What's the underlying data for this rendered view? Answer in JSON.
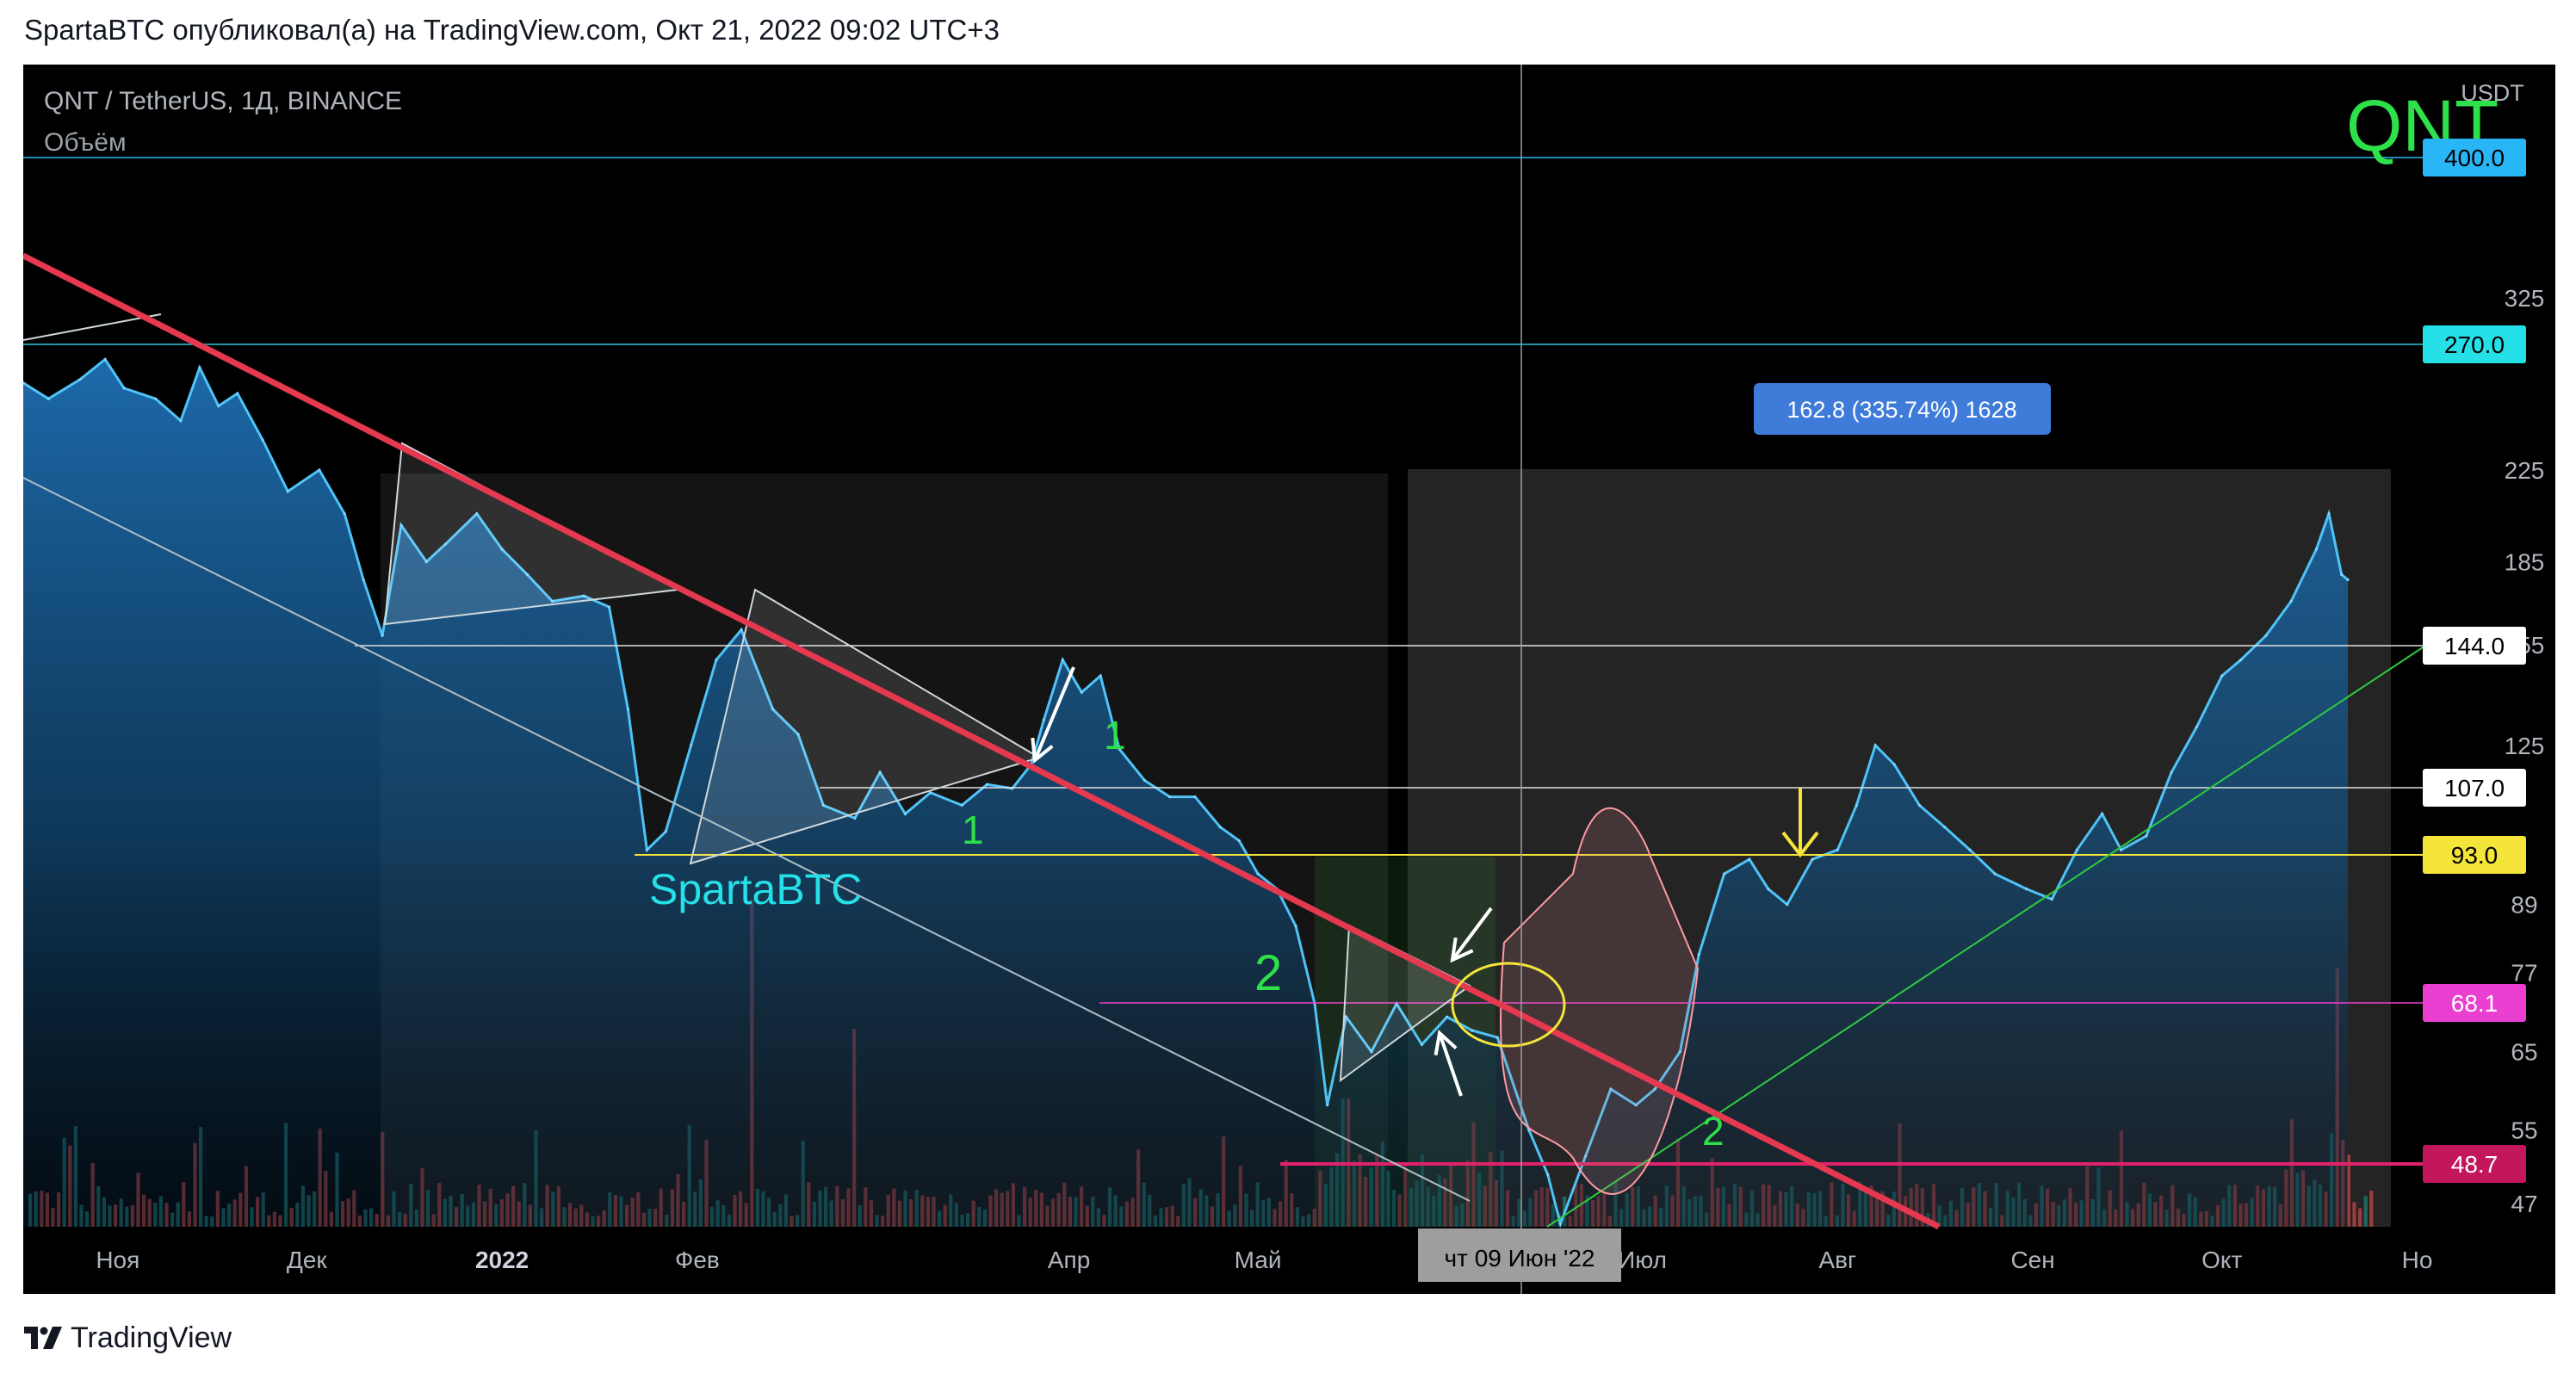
{
  "header": {
    "caption": "SpartaBTC опубликовал(а) на TradingView.com, Окт 21, 2022 09:02 UTC+3"
  },
  "footer": {
    "brand": "TradingView"
  },
  "chart": {
    "symbol_title": "QNT / TetherUS, 1Д, BINANCE",
    "volume_label": "Объём",
    "currency": "USDT",
    "watermark": "QNT",
    "author_tag": "SpartaBTC",
    "measure_label": "162.8 (335.74%) 1628",
    "crosshair_date": "чт 09 Июн '22",
    "annotations": {
      "one_a": "1",
      "one_b": "1",
      "two_a": "2",
      "two_b": "2"
    }
  },
  "chart_data": {
    "type": "area",
    "title": "QNT / TetherUS, 1Д, BINANCE",
    "y_scale": "log",
    "ylim": [
      44,
      470
    ],
    "y_ticks": [
      47.0,
      55.0,
      65.0,
      77.0,
      89.0,
      125.0,
      155.0,
      185.0,
      225.0,
      325.0
    ],
    "x_ticks": [
      "Ноя",
      "Дек",
      "2022",
      "Фев",
      "Апр",
      "Май",
      "Июл",
      "Авг",
      "Сен",
      "Окт",
      "Но"
    ],
    "x_tick_dates": [
      "2021-11-01",
      "2021-12-01",
      "2022-01-01",
      "2022-02-01",
      "2022-04-01",
      "2022-05-01",
      "2022-07-01",
      "2022-08-01",
      "2022-09-01",
      "2022-10-01",
      "2022-11-01"
    ],
    "price_labels": [
      {
        "value": "400.0",
        "bg": "#29b6f6",
        "fg": "#000000"
      },
      {
        "value": "270.0",
        "bg": "#26e0e8",
        "fg": "#000000"
      },
      {
        "value": "144.0",
        "bg": "#ffffff",
        "fg": "#000000"
      },
      {
        "value": "107.0",
        "bg": "#ffffff",
        "fg": "#000000"
      },
      {
        "value": "93.0",
        "bg": "#f5e43a",
        "fg": "#000000"
      },
      {
        "value": "68.1",
        "bg": "#ea3fd0",
        "fg": "#ffffff"
      },
      {
        "value": "48.7",
        "bg": "#c2185b",
        "fg": "#ffffff"
      }
    ],
    "series": [
      {
        "name": "QNT/USDT close",
        "color": "#4fc3f7",
        "points": [
          [
            "2021-10-17",
            271
          ],
          [
            "2021-10-21",
            262
          ],
          [
            "2021-10-26",
            273
          ],
          [
            "2021-10-30",
            285
          ],
          [
            "2021-11-02",
            268
          ],
          [
            "2021-11-07",
            262
          ],
          [
            "2021-11-11",
            250
          ],
          [
            "2021-11-14",
            280
          ],
          [
            "2021-11-17",
            258
          ],
          [
            "2021-11-20",
            265
          ],
          [
            "2021-11-24",
            240
          ],
          [
            "2021-11-28",
            215
          ],
          [
            "2021-12-03",
            225
          ],
          [
            "2021-12-07",
            205
          ],
          [
            "2021-12-10",
            178
          ],
          [
            "2021-12-13",
            158
          ],
          [
            "2021-12-16",
            200
          ],
          [
            "2021-12-20",
            185
          ],
          [
            "2021-12-23",
            192
          ],
          [
            "2021-12-28",
            205
          ],
          [
            "2022-01-01",
            190
          ],
          [
            "2022-01-05",
            180
          ],
          [
            "2022-01-09",
            170
          ],
          [
            "2022-01-14",
            172
          ],
          [
            "2022-01-18",
            168
          ],
          [
            "2022-01-21",
            135
          ],
          [
            "2022-01-24",
            100
          ],
          [
            "2022-01-27",
            104
          ],
          [
            "2022-01-31",
            125
          ],
          [
            "2022-02-04",
            150
          ],
          [
            "2022-02-08",
            160
          ],
          [
            "2022-02-13",
            135
          ],
          [
            "2022-02-17",
            128
          ],
          [
            "2022-02-21",
            110
          ],
          [
            "2022-02-26",
            107
          ],
          [
            "2022-03-02",
            118
          ],
          [
            "2022-03-06",
            108
          ],
          [
            "2022-03-10",
            113
          ],
          [
            "2022-03-15",
            110
          ],
          [
            "2022-03-19",
            115
          ],
          [
            "2022-03-23",
            114
          ],
          [
            "2022-03-26",
            120
          ],
          [
            "2022-03-28",
            132
          ],
          [
            "2022-03-31",
            150
          ],
          [
            "2022-04-03",
            140
          ],
          [
            "2022-04-06",
            145
          ],
          [
            "2022-04-09",
            124
          ],
          [
            "2022-04-13",
            116
          ],
          [
            "2022-04-17",
            112
          ],
          [
            "2022-04-21",
            112
          ],
          [
            "2022-04-25",
            105
          ],
          [
            "2022-04-28",
            102
          ],
          [
            "2022-05-01",
            95
          ],
          [
            "2022-05-04",
            92
          ],
          [
            "2022-05-07",
            85
          ],
          [
            "2022-05-10",
            72
          ],
          [
            "2022-05-12",
            58
          ],
          [
            "2022-05-15",
            70
          ],
          [
            "2022-05-19",
            65
          ],
          [
            "2022-05-23",
            72
          ],
          [
            "2022-05-27",
            66
          ],
          [
            "2022-05-31",
            70
          ],
          [
            "2022-06-04",
            68
          ],
          [
            "2022-06-08",
            67
          ],
          [
            "2022-06-13",
            55
          ],
          [
            "2022-06-16",
            50
          ],
          [
            "2022-06-18",
            45
          ],
          [
            "2022-06-22",
            52
          ],
          [
            "2022-06-26",
            60
          ],
          [
            "2022-06-30",
            58
          ],
          [
            "2022-07-03",
            60
          ],
          [
            "2022-07-07",
            65
          ],
          [
            "2022-07-10",
            80
          ],
          [
            "2022-07-14",
            95
          ],
          [
            "2022-07-18",
            98
          ],
          [
            "2022-07-21",
            92
          ],
          [
            "2022-07-24",
            89
          ],
          [
            "2022-07-28",
            98
          ],
          [
            "2022-08-01",
            100
          ],
          [
            "2022-08-04",
            110
          ],
          [
            "2022-08-07",
            125
          ],
          [
            "2022-08-10",
            120
          ],
          [
            "2022-08-14",
            110
          ],
          [
            "2022-08-18",
            105
          ],
          [
            "2022-08-22",
            100
          ],
          [
            "2022-08-26",
            95
          ],
          [
            "2022-08-31",
            92
          ],
          [
            "2022-09-04",
            90
          ],
          [
            "2022-09-08",
            100
          ],
          [
            "2022-09-12",
            108
          ],
          [
            "2022-09-15",
            100
          ],
          [
            "2022-09-19",
            103
          ],
          [
            "2022-09-23",
            118
          ],
          [
            "2022-09-27",
            130
          ],
          [
            "2022-10-01",
            145
          ],
          [
            "2022-10-04",
            150
          ],
          [
            "2022-10-08",
            158
          ],
          [
            "2022-10-12",
            170
          ],
          [
            "2022-10-16",
            190
          ],
          [
            "2022-10-18",
            205
          ],
          [
            "2022-10-20",
            180
          ],
          [
            "2022-10-21",
            178
          ]
        ]
      }
    ]
  }
}
